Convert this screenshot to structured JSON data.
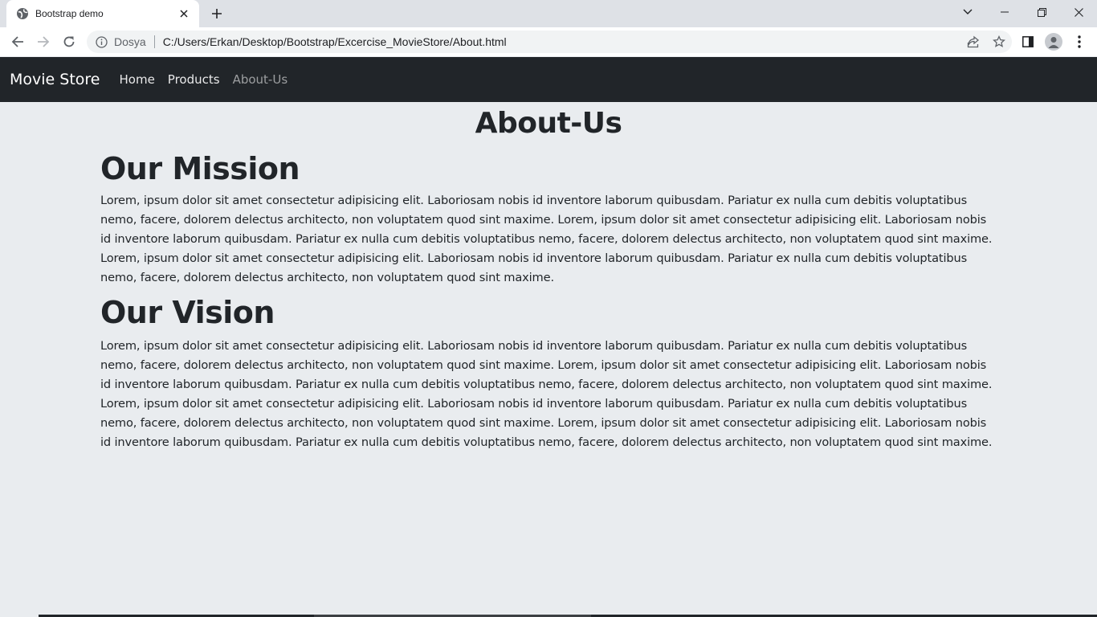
{
  "browser": {
    "tab": {
      "title": "Bootstrap demo",
      "favicon": "globe-icon"
    },
    "address_bar": {
      "scheme_label": "Dosya",
      "url": "C:/Users/Erkan/Desktop/Bootstrap/Excercise_MovieStore/About.html"
    },
    "colors": {
      "tab_strip": "#dee1e6",
      "toolbar": "#ffffff",
      "omnibox": "#f1f3f4"
    }
  },
  "navbar": {
    "brand": "Movie Store",
    "links": [
      {
        "label": "Home"
      },
      {
        "label": "Products"
      },
      {
        "label": "About-Us"
      }
    ],
    "colors": {
      "background": "#212529",
      "active_link": "#8e9195"
    }
  },
  "main": {
    "title": "About-Us",
    "mission": {
      "heading": "Our Mission",
      "text": "Lorem, ipsum dolor sit amet consectetur adipisicing elit. Laboriosam nobis id inventore laborum quibusdam. Pariatur ex nulla cum debitis voluptatibus nemo, facere, dolorem delectus architecto, non voluptatem quod sint maxime. Lorem, ipsum dolor sit amet consectetur adipisicing elit. Laboriosam nobis id inventore laborum quibusdam. Pariatur ex nulla cum debitis voluptatibus nemo, facere, dolorem delectus architecto, non voluptatem quod sint maxime. Lorem, ipsum dolor sit amet consectetur adipisicing elit. Laboriosam nobis id inventore laborum quibusdam. Pariatur ex nulla cum debitis voluptatibus nemo, facere, dolorem delectus architecto, non voluptatem quod sint maxime."
    },
    "vision": {
      "heading": "Our Vision",
      "text": "Lorem, ipsum dolor sit amet consectetur adipisicing elit. Laboriosam nobis id inventore laborum quibusdam. Pariatur ex nulla cum debitis voluptatibus nemo, facere, dolorem delectus architecto, non voluptatem quod sint maxime. Lorem, ipsum dolor sit amet consectetur adipisicing elit. Laboriosam nobis id inventore laborum quibusdam. Pariatur ex nulla cum debitis voluptatibus nemo, facere, dolorem delectus architecto, non voluptatem quod sint maxime. Lorem, ipsum dolor sit amet consectetur adipisicing elit. Laboriosam nobis id inventore laborum quibusdam. Pariatur ex nulla cum debitis voluptatibus nemo, facere, dolorem delectus architecto, non voluptatem quod sint maxime. Lorem, ipsum dolor sit amet consectetur adipisicing elit. Laboriosam nobis id inventore laborum quibusdam. Pariatur ex nulla cum debitis voluptatibus nemo, facere, dolorem delectus architecto, non voluptatem quod sint maxime."
    },
    "colors": {
      "page_background": "#e9ecef",
      "text": "#212529"
    }
  }
}
